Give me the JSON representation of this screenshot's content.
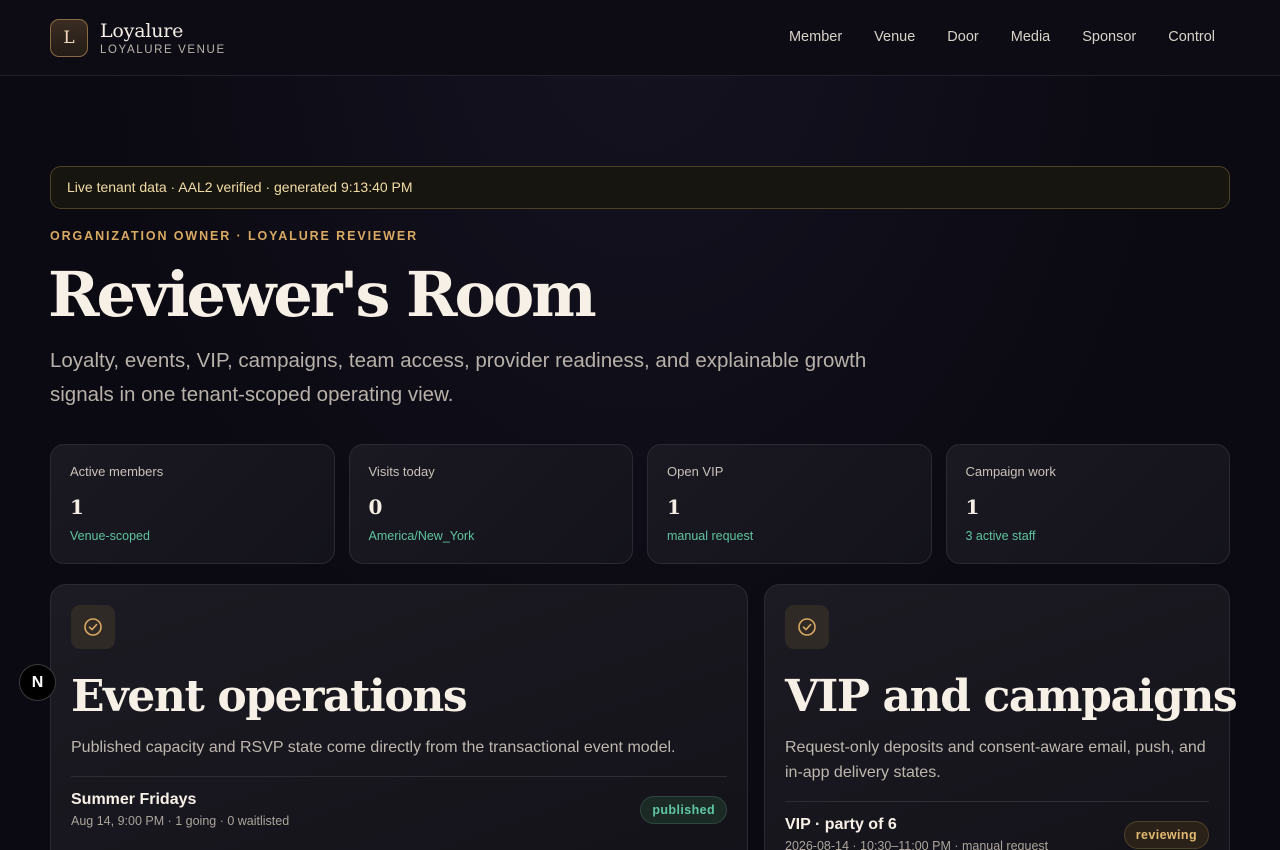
{
  "header": {
    "logo_letter": "L",
    "brand_name": "Loyalure",
    "brand_sub": "LOYALURE VENUE",
    "nav": [
      "Member",
      "Venue",
      "Door",
      "Media",
      "Sponsor",
      "Control"
    ]
  },
  "banner": {
    "text": "Live tenant data · AAL2 verified · generated 9:13:40 PM"
  },
  "hero": {
    "eyebrow": "ORGANIZATION OWNER · LOYALURE REVIEWER",
    "title": "Reviewer's Room",
    "subtitle": "Loyalty, events, VIP, campaigns, team access, provider readiness, and explainable growth signals in one tenant-scoped operating view."
  },
  "stats": [
    {
      "label": "Active members",
      "value": "1",
      "note": "Venue-scoped"
    },
    {
      "label": "Visits today",
      "value": "0",
      "note": "America/New_York"
    },
    {
      "label": "Open VIP",
      "value": "1",
      "note": "manual request"
    },
    {
      "label": "Campaign work",
      "value": "1",
      "note": "3 active staff"
    }
  ],
  "events_panel": {
    "title": "Event operations",
    "description": "Published capacity and RSVP state come directly from the transactional event model.",
    "rows": [
      {
        "title": "Summer Fridays",
        "meta": "Aug 14, 9:00 PM · 1 going · 0 waitlisted",
        "status": "published"
      }
    ]
  },
  "vip_panel": {
    "title": "VIP and campaigns",
    "description": "Request-only deposits and consent-aware email, push, and in-app delivery states.",
    "rows": [
      {
        "title": "VIP · party of 6",
        "meta": "2026-08-14 · 10:30–11:00 PM · manual request",
        "status": "reviewing"
      }
    ]
  },
  "dev_indicator": "N",
  "colors": {
    "accent": "#d9a962",
    "success": "#5ec3a1",
    "background": "#0b0a12"
  }
}
